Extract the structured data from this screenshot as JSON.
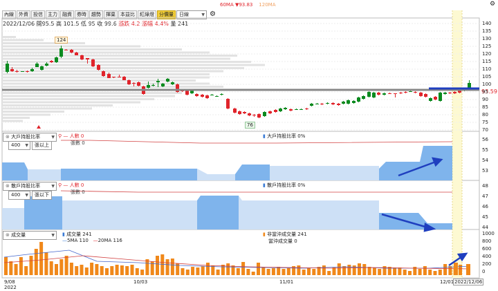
{
  "legend_top": {
    "ma60": "60MA ▼93.83",
    "ma120": "120MA"
  },
  "corner_icon": "settings-icon",
  "toolbar": {
    "tabs": [
      "內線",
      "外資",
      "投信",
      "主力",
      "融資",
      "券時",
      "趨勢",
      "揮棄",
      "本益比",
      "紅綠燈",
      "分價量"
    ],
    "active_index": 10,
    "period_select": "日線"
  },
  "price_info": {
    "date": "2022/12/06",
    "open_label": "開",
    "open": "95.5",
    "high_label": "高",
    "high": "101.5",
    "low_label": "低",
    "low": "95",
    "close_label": "收",
    "close": "99.6",
    "change_label": "漲跌",
    "change": "4.2",
    "pct_label": "漲幅",
    "pct": "4.4%",
    "vol_label": "量",
    "vol": "241"
  },
  "price_panel": {
    "y_ticks": [
      "140",
      "135",
      "130",
      "125",
      "120",
      "115",
      "110",
      "105",
      "100",
      "95",
      "90",
      "85",
      "80",
      "75",
      "70"
    ],
    "current_price": "93.59",
    "high_label": "124",
    "low_label": "76"
  },
  "panel_big_holder": {
    "indicator": "大戶持股比率",
    "holder_select": "400",
    "range_button": "張以上",
    "series_people": "人數 0",
    "series_shares": "張數 0",
    "ratio": "大戶持股比率 0%",
    "y_ticks": [
      "56",
      "55",
      "54",
      "53"
    ]
  },
  "panel_small_holder": {
    "indicator": "散戶持股比率",
    "holder_select": "400",
    "range_button": "張以下",
    "series_people": "人數 0",
    "series_shares": "張數 0",
    "ratio": "散戶持股比率 0%",
    "y_ticks": [
      "48",
      "47",
      "46",
      "45",
      "44"
    ]
  },
  "panel_volume": {
    "indicator": "成交量",
    "vol": "成交量 241",
    "ma5": "5MA 110",
    "ma20": "20MA 116",
    "non_day_trade": "非當沖成交量 241",
    "day_trade": "當沖成交量 0",
    "y_ticks": [
      "1000",
      "800",
      "600",
      "400",
      "200",
      "0"
    ]
  },
  "x_axis": {
    "labels": [
      "9/08",
      "10/03",
      "11/01",
      "12/01"
    ],
    "year": "2022",
    "cursor_date": "2022/12/06"
  },
  "colors": {
    "up": "#e0242b",
    "down": "#0b8a1f",
    "volume": "#f0881a",
    "holder_fill": "#cde0f6",
    "holder_dark": "#7fb4ec",
    "arrow": "#1f3fbf"
  }
}
